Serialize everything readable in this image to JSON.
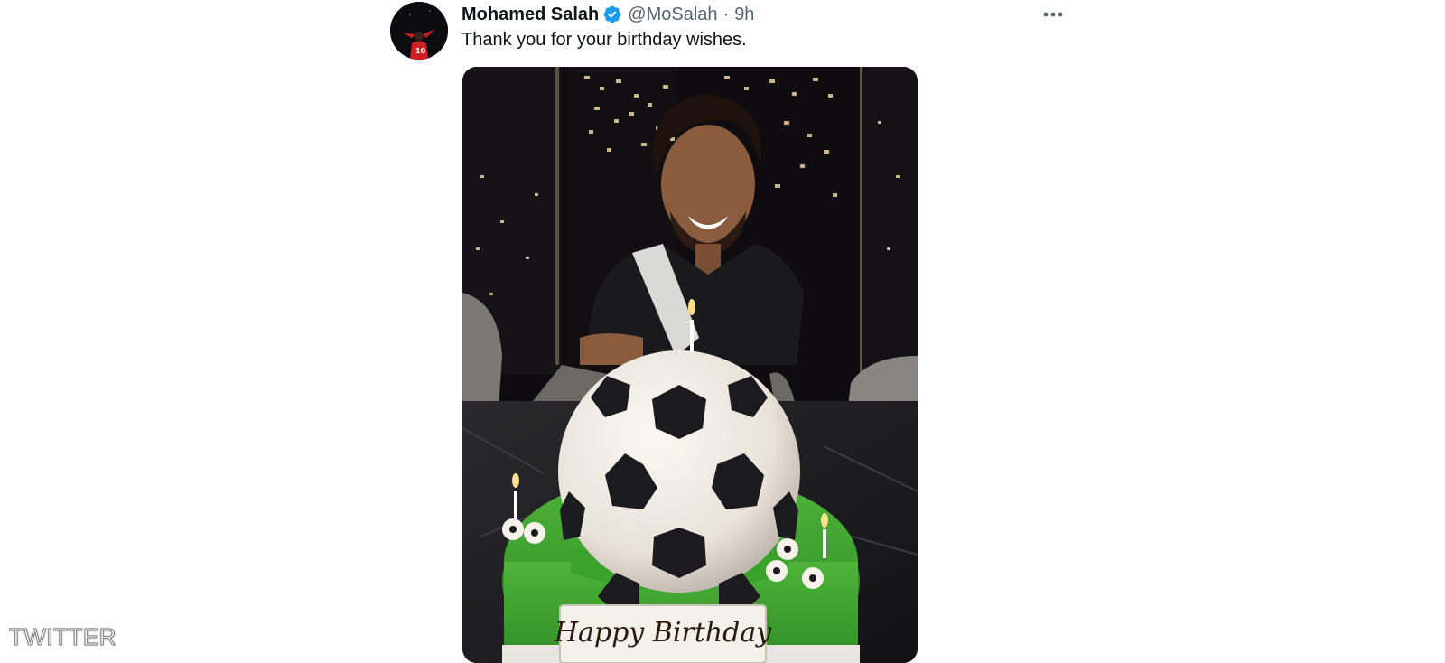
{
  "tweet": {
    "author": {
      "name": "Mohamed Salah",
      "handle": "@MoSalah",
      "verified": true
    },
    "separator": "·",
    "time": "9h",
    "text": "Thank you for your birthday wishes.",
    "more_icon": "more-horizontal-icon",
    "media": {
      "cake_label": "Happy Birthday"
    }
  },
  "watermark": "TWITTER",
  "colors": {
    "verified_blue": "#1d9bf0",
    "secondary_text": "#536471",
    "primary_text": "#0f1419"
  }
}
